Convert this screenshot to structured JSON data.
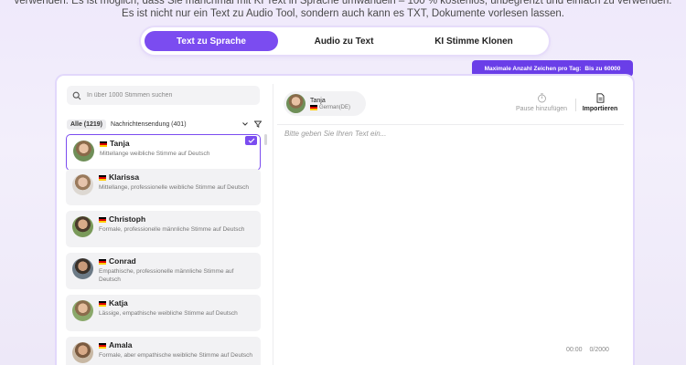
{
  "intro": {
    "line1": "verwenden. Es ist möglich, dass Sie manchmal mit KI Text in Sprache umwandeln – 100 % kostenlos, unbegrenzt und einfach zu verwenden.",
    "line2": "Es ist nicht nur ein Text zu Audio Tool, sondern auch kann es TXT, Dokumente vorlesen lassen."
  },
  "tabs": [
    {
      "label": "Text zu Sprache",
      "active": true
    },
    {
      "label": "Audio zu Text",
      "active": false
    },
    {
      "label": "KI Stimme Klonen",
      "active": false
    }
  ],
  "limit_badge": {
    "label": "Maximale Anzahl Zeichen pro Tag:",
    "value": "Bis zu 60000"
  },
  "search": {
    "placeholder": "In über 1000 Stimmen suchen"
  },
  "filters": {
    "all": "Alle (1219)",
    "news": "Nachrichtensendung (401)"
  },
  "voices": [
    {
      "name": "Tanja",
      "desc": "Mittellange weibliche Stimme auf Deutsch",
      "selected": true
    },
    {
      "name": "Klarissa",
      "desc": "Mittellange, professionelle weibliche Stimme auf Deutsch",
      "selected": false
    },
    {
      "name": "Christoph",
      "desc": "Formale, professionelle männliche Stimme auf Deutsch",
      "selected": false
    },
    {
      "name": "Conrad",
      "desc": "Empathische, professionelle männliche Stimme auf Deutsch",
      "selected": false
    },
    {
      "name": "Katja",
      "desc": "Lässige, empathische weibliche Stimme auf Deutsch",
      "selected": false
    },
    {
      "name": "Amala",
      "desc": "Formale, aber empathische weibliche Stimme auf Deutsch",
      "selected": false
    }
  ],
  "editor": {
    "voice_name": "Tanja",
    "voice_lang": "German(DE)",
    "pause_label": "Pause hinzufügen",
    "import_label": "Importieren",
    "placeholder": "Bitte geben Sie Ihren Text ein...",
    "time": "00:00",
    "char_count": "0/2000"
  },
  "colors": {
    "accent": "#7b4cf0",
    "badge": "#6a3ee8"
  }
}
